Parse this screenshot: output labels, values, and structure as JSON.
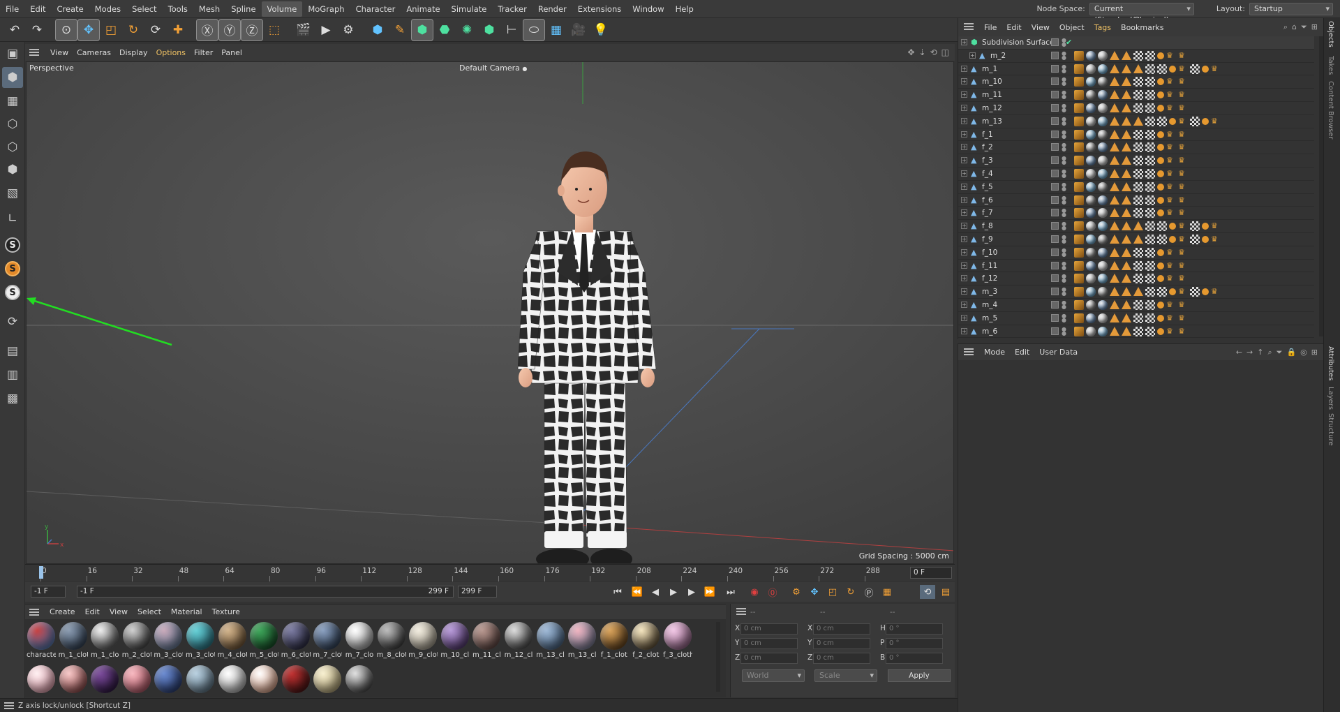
{
  "menubar": {
    "items": [
      "File",
      "Edit",
      "Create",
      "Modes",
      "Select",
      "Tools",
      "Mesh",
      "Spline",
      "Volume",
      "MoGraph",
      "Character",
      "Animate",
      "Simulate",
      "Tracker",
      "Render",
      "Extensions",
      "Window",
      "Help"
    ],
    "active_index": 8,
    "node_space_label": "Node Space:",
    "node_space_value": "Current (Standard/Physical)",
    "layout_label": "Layout:",
    "layout_value": "Startup"
  },
  "toolbar": {
    "icons": [
      "undo-icon",
      "redo-icon",
      "live-selection-icon",
      "move-icon",
      "scale-icon",
      "rotate-icon",
      "dim-icon",
      "add-icon",
      "x-axis-icon",
      "y-axis-icon",
      "z-axis-icon",
      "coordinate-system-icon",
      "render-region-icon",
      "render-view-icon",
      "render-settings-icon",
      "cube-icon",
      "pen-icon",
      "subdivision-icon",
      "extrude-icon",
      "cloner-icon",
      "array-icon",
      "deformer-icon",
      "bend-icon",
      "floor-icon",
      "camera-icon",
      "light-icon"
    ]
  },
  "viewport": {
    "menu": [
      "View",
      "Cameras",
      "Display",
      "Options",
      "Filter",
      "Panel"
    ],
    "active_menu": 3,
    "view_name": "Perspective",
    "camera": "Default Camera",
    "grid_spacing": "Grid Spacing : 5000 cm"
  },
  "timeline": {
    "ticks": [
      "0",
      "16",
      "32",
      "48",
      "64",
      "80",
      "96",
      "112",
      "128",
      "144",
      "160",
      "176",
      "192",
      "208",
      "224",
      "240",
      "256",
      "272",
      "288"
    ],
    "current_frame": "0 F"
  },
  "transport": {
    "start": "-1 F",
    "range_start": "-1 F",
    "range_end": "299 F",
    "end": "299 F"
  },
  "materials": {
    "menu": [
      "Create",
      "Edit",
      "View",
      "Select",
      "Material",
      "Texture"
    ],
    "row1": [
      {
        "label": "characte",
        "c1": "#c84040",
        "c2": "#3c8fd8"
      },
      {
        "label": "m_1_clot",
        "c1": "#8a9bb0",
        "c2": "#1f2d40"
      },
      {
        "label": "m_1_clo",
        "c1": "#eeeeee",
        "c2": "#333333"
      },
      {
        "label": "m_2_clot",
        "c1": "#d0d0d0",
        "c2": "#222222"
      },
      {
        "label": "m_3_clot",
        "c1": "#c9a9b9",
        "c2": "#4d6f8f"
      },
      {
        "label": "m_3_clot",
        "c1": "#66d0d6",
        "c2": "#1e5f70"
      },
      {
        "label": "m_4_clot",
        "c1": "#d2b48c",
        "c2": "#5a3f22"
      },
      {
        "label": "m_5_clot",
        "c1": "#3ea65a",
        "c2": "#0e3a1c"
      },
      {
        "label": "m_6_clot",
        "c1": "#7a7aa0",
        "c2": "#1b1b2e"
      },
      {
        "label": "m_7_clot",
        "c1": "#8aa0c0",
        "c2": "#1c2a3e"
      },
      {
        "label": "m_7_clo",
        "c1": "#ffffff",
        "c2": "#8a8a8a"
      },
      {
        "label": "m_8_clot",
        "c1": "#bcbcbc",
        "c2": "#1c1c1c"
      },
      {
        "label": "m_9_clot",
        "c1": "#f2ede0",
        "c2": "#8d8575"
      },
      {
        "label": "m_10_cl",
        "c1": "#b79ad8",
        "c2": "#3d2357"
      },
      {
        "label": "m_11_cl",
        "c1": "#b89890",
        "c2": "#4a3431"
      },
      {
        "label": "m_12_cl",
        "c1": "#dcdcdc",
        "c2": "#262626"
      },
      {
        "label": "m_13_cl",
        "c1": "#9fb9d6",
        "c2": "#36506e"
      },
      {
        "label": "m_13_cl",
        "c1": "#f0b4c0",
        "c2": "#5a6e8a"
      },
      {
        "label": "f_1_clot",
        "c1": "#d9a35b",
        "c2": "#4a2e10"
      },
      {
        "label": "f_2_clot",
        "c1": "#f5e6c0",
        "c2": "#3a2a14"
      },
      {
        "label": "f_3_cloth",
        "c1": "#f2c8e6",
        "c2": "#7a4a6e"
      }
    ],
    "row2": [
      {
        "c1": "#fff0f2",
        "c2": "#d88a9a"
      },
      {
        "c1": "#f8c8c8",
        "c2": "#7a3030"
      },
      {
        "c1": "#7a4a9a",
        "c2": "#1e0e2e"
      },
      {
        "c1": "#f8b8c0",
        "c2": "#a04050"
      },
      {
        "c1": "#6a8ad0",
        "c2": "#1e2e5e"
      },
      {
        "c1": "#b8d0e0",
        "c2": "#4a6070"
      },
      {
        "c1": "#ffffff",
        "c2": "#9a9a9a"
      },
      {
        "c1": "#ffffff",
        "c2": "#d08a6a"
      },
      {
        "c1": "#c03030",
        "c2": "#301010"
      },
      {
        "c1": "#f8f0d0",
        "c2": "#a09060"
      },
      {
        "c1": "#e0e0e0",
        "c2": "#202020"
      }
    ]
  },
  "coords": {
    "header": [
      "--",
      "--",
      "--"
    ],
    "rows": [
      {
        "a": "X",
        "av": "0 cm",
        "b": "X",
        "bv": "0 cm",
        "c": "H",
        "cv": "0 °"
      },
      {
        "a": "Y",
        "av": "0 cm",
        "b": "Y",
        "bv": "0 cm",
        "c": "P",
        "cv": "0 °"
      },
      {
        "a": "Z",
        "av": "0 cm",
        "b": "Z",
        "bv": "0 cm",
        "c": "B",
        "cv": "0 °"
      }
    ],
    "mode1": "World",
    "mode2": "Scale",
    "apply": "Apply"
  },
  "status": "Z axis lock/unlock [Shortcut Z]",
  "objects": {
    "menu": [
      "File",
      "Edit",
      "View",
      "Object",
      "Tags",
      "Bookmarks"
    ],
    "active_menu": 4,
    "rows": [
      {
        "name": "Subdivision Surface",
        "indent": 0,
        "type": "subdiv"
      },
      {
        "name": "m_2",
        "indent": 1,
        "tags": 10
      },
      {
        "name": "m_1",
        "indent": 0,
        "tags": 13
      },
      {
        "name": "m_10",
        "indent": 0,
        "tags": 10
      },
      {
        "name": "m_11",
        "indent": 0,
        "tags": 10
      },
      {
        "name": "m_12",
        "indent": 0,
        "tags": 10
      },
      {
        "name": "m_13",
        "indent": 0,
        "tags": 13
      },
      {
        "name": "f_1",
        "indent": 0,
        "tags": 10
      },
      {
        "name": "f_2",
        "indent": 0,
        "tags": 10
      },
      {
        "name": "f_3",
        "indent": 0,
        "tags": 10
      },
      {
        "name": "f_4",
        "indent": 0,
        "tags": 10
      },
      {
        "name": "f_5",
        "indent": 0,
        "tags": 10
      },
      {
        "name": "f_6",
        "indent": 0,
        "tags": 10
      },
      {
        "name": "f_7",
        "indent": 0,
        "tags": 10
      },
      {
        "name": "f_8",
        "indent": 0,
        "tags": 13
      },
      {
        "name": "f_9",
        "indent": 0,
        "tags": 13
      },
      {
        "name": "f_10",
        "indent": 0,
        "tags": 10
      },
      {
        "name": "f_11",
        "indent": 0,
        "tags": 10
      },
      {
        "name": "f_12",
        "indent": 0,
        "tags": 10
      },
      {
        "name": "m_3",
        "indent": 0,
        "tags": 13
      },
      {
        "name": "m_4",
        "indent": 0,
        "tags": 10
      },
      {
        "name": "m_5",
        "indent": 0,
        "tags": 10
      },
      {
        "name": "m_6",
        "indent": 0,
        "tags": 10
      }
    ]
  },
  "attributes": {
    "menu": [
      "Mode",
      "Edit",
      "User Data"
    ]
  },
  "vtabs": [
    "Objects",
    "Takes",
    "Content Browser",
    "Attributes",
    "Layers",
    "Structure"
  ],
  "colors": {
    "accent": "#f0c264",
    "arrow": "#22dd22"
  }
}
